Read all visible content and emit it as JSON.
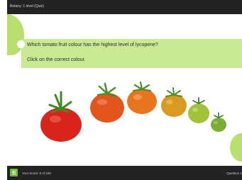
{
  "header": {
    "title": "Botany: 1 level (Quiz)"
  },
  "question": {
    "text": "Which tomato fruit colour has the highest level of lycopene?",
    "instruction": "Click on the correct colour."
  },
  "options": [
    {
      "name": "red-tomato",
      "color": "#d9241b"
    },
    {
      "name": "red-orange-tomato",
      "color": "#e3551c"
    },
    {
      "name": "orange-tomato",
      "color": "#e8741d"
    },
    {
      "name": "orange-yellow-tomato",
      "color": "#d99a22"
    },
    {
      "name": "yellow-green-tomato",
      "color": "#a3c23a"
    },
    {
      "name": "green-tomato",
      "color": "#7aae35"
    }
  ],
  "footer": {
    "menu_icon": "menu-icon",
    "score": "Your Score: 0 of 240",
    "question_number": "Question 2"
  },
  "colors": {
    "bar": "#232323",
    "accent_green": "#b9e06f",
    "question_bg": "#c9e992"
  }
}
